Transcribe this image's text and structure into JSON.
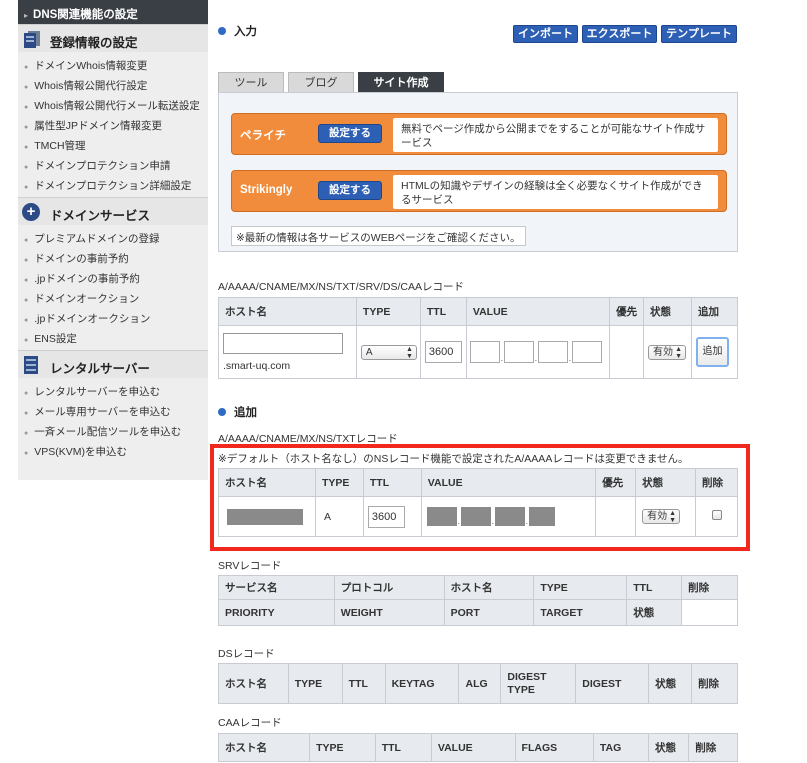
{
  "sidebar": {
    "top_item": "DNS関連機能の設定",
    "sections": [
      {
        "title": "登録情報の設定",
        "icon": "database-icon",
        "items": [
          "ドメインWhois情報変更",
          "Whois情報公開代行設定",
          "Whois情報公開代行メール転送設定",
          "属性型JPドメイン情報変更",
          "TMCH管理",
          "ドメインプロテクション申請",
          "ドメインプロテクション詳細設定"
        ]
      },
      {
        "title": "ドメインサービス",
        "icon": "plus-circle-icon",
        "items": [
          "プレミアムドメインの登録",
          "ドメインの事前予約",
          ".jpドメインの事前予約",
          "ドメインオークション",
          ".jpドメインオークション",
          "ENS設定"
        ]
      },
      {
        "title": "レンタルサーバー",
        "icon": "server-icon",
        "items": [
          "レンタルサーバーを申込む",
          "メール専用サーバーを申込む",
          "一斉メール配信ツールを申込む",
          "VPS(KVM)を申込む"
        ]
      }
    ]
  },
  "input_section": {
    "title": "入力",
    "buttons": [
      "インポート",
      "エクスポート",
      "テンプレート"
    ],
    "tabs": [
      "ツール",
      "ブログ",
      "サイト作成"
    ],
    "active_tab": 2,
    "services": [
      {
        "name": "ペライチ",
        "button": "設定する",
        "description": "無料でページ作成から公開までをすることが可能なサイト作成サービス"
      },
      {
        "name": "Strikingly",
        "button": "設定する",
        "description": "HTMLの知識やデザインの経験は全く必要なくサイト作成ができるサービス"
      }
    ],
    "notice": "※最新の情報は各サービスのWEBページをご確認ください。"
  },
  "input_table": {
    "caption": "A/AAAA/CNAME/MX/NS/TXT/SRV/DS/CAAレコード",
    "headers": [
      "ホスト名",
      "TYPE",
      "TTL",
      "VALUE",
      "優先",
      "状態",
      "追加"
    ],
    "hostname_value": "",
    "domain_suffix": ".smart-uq.com",
    "type_value": "A",
    "ttl_value": "3600",
    "status_value": "有効",
    "add_button": "追加"
  },
  "added_section": {
    "title": "追加",
    "caption": "A/AAAA/CNAME/MX/NS/TXTレコード",
    "note": "※デフォルト（ホスト名なし）のNSレコード機能で設定されたA/AAAAレコードは変更できません。",
    "headers": [
      "ホスト名",
      "TYPE",
      "TTL",
      "VALUE",
      "優先",
      "状態",
      "削除"
    ],
    "row": {
      "type": "A",
      "ttl": "3600",
      "status": "有効"
    }
  },
  "srv": {
    "caption": "SRVレコード",
    "row1": [
      "サービス名",
      "プロトコル",
      "ホスト名",
      "TYPE",
      "TTL",
      "削除"
    ],
    "row2": [
      "PRIORITY",
      "WEIGHT",
      "PORT",
      "TARGET",
      "状態"
    ]
  },
  "ds": {
    "caption": "DSレコード",
    "headers": [
      "ホスト名",
      "TYPE",
      "TTL",
      "KEYTAG",
      "ALG",
      "DIGEST TYPE",
      "DIGEST",
      "状態",
      "削除"
    ]
  },
  "caa": {
    "caption": "CAAレコード",
    "headers": [
      "ホスト名",
      "TYPE",
      "TTL",
      "VALUE",
      "FLAGS",
      "TAG",
      "状態",
      "削除"
    ]
  },
  "colors": {
    "accent_blue": "#2d5fb4",
    "orange": "#f08c3b",
    "dark": "#3a3f45",
    "highlight_red": "#f0281e"
  }
}
